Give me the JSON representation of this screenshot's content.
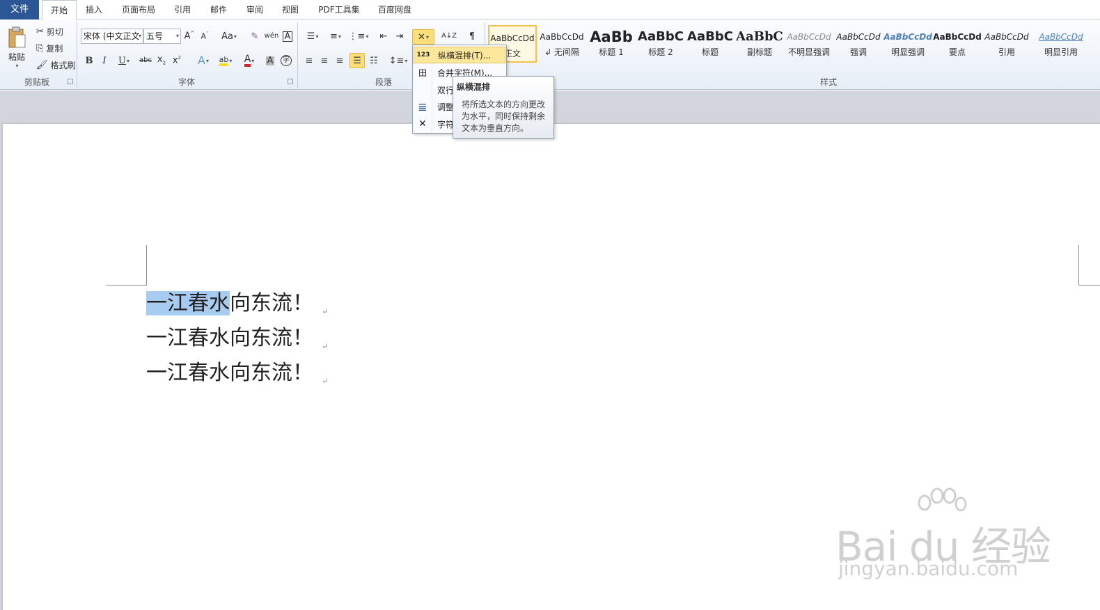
{
  "tabs": {
    "file": "文件",
    "items": [
      "开始",
      "插入",
      "页面布局",
      "引用",
      "邮件",
      "审阅",
      "视图",
      "PDF工具集",
      "百度网盘"
    ]
  },
  "clipboard": {
    "paste": "粘贴",
    "cut": "剪切",
    "copy": "复制",
    "format_painter": "格式刷",
    "group_label": "剪贴板"
  },
  "font": {
    "name_value": "宋体 (中文正⽂",
    "size_value": "五号",
    "group_label": "字体",
    "highlight_color": "#ffe100",
    "font_color": "#e31b23"
  },
  "paragraph": {
    "group_label": "段落"
  },
  "styles": {
    "group_label": "样式",
    "items": [
      {
        "sample": "AaBbCcDd",
        "name": "正文"
      },
      {
        "sample": "AaBbCcDd",
        "name": "↲ 无间隔"
      },
      {
        "sample": "AaBb",
        "name": "标题 1"
      },
      {
        "sample": "AaBbC",
        "name": "标题 2"
      },
      {
        "sample": "AaBbC",
        "name": "标题"
      },
      {
        "sample": "AaBbC",
        "name": "副标题"
      },
      {
        "sample": "AaBbCcDd",
        "name": "不明显强调"
      },
      {
        "sample": "AaBbCcDd",
        "name": "强调"
      },
      {
        "sample": "AaBbCcDd",
        "name": "明显强调"
      },
      {
        "sample": "AaBbCcDd",
        "name": "要点"
      },
      {
        "sample": "AaBbCcDd",
        "name": "引用"
      },
      {
        "sample": "AaBbCcDd",
        "name": "明显引用"
      }
    ]
  },
  "menu": {
    "items": [
      {
        "icon": "123",
        "label": "纵横混排(T)..."
      },
      {
        "icon": "田",
        "label": "合并字符(M)..."
      },
      {
        "icon": "",
        "label": "双行"
      },
      {
        "icon": "≣",
        "label": "调整"
      },
      {
        "icon": "✕",
        "label": "字符"
      }
    ]
  },
  "tooltip": {
    "title": "纵横混排",
    "body": "将所选文本的方向更改为水平，同时保持剩余文本为垂直方向。"
  },
  "document": {
    "lines": [
      {
        "selected": "一江春水",
        "rest": "向东流！"
      },
      {
        "selected": "",
        "rest": "一江春水向东流！"
      },
      {
        "selected": "",
        "rest": "一江春水向东流！"
      }
    ],
    "para_mark": "↵"
  },
  "watermark": {
    "main": "Bai du 经验",
    "sub": "jingyan.baidu.com"
  }
}
